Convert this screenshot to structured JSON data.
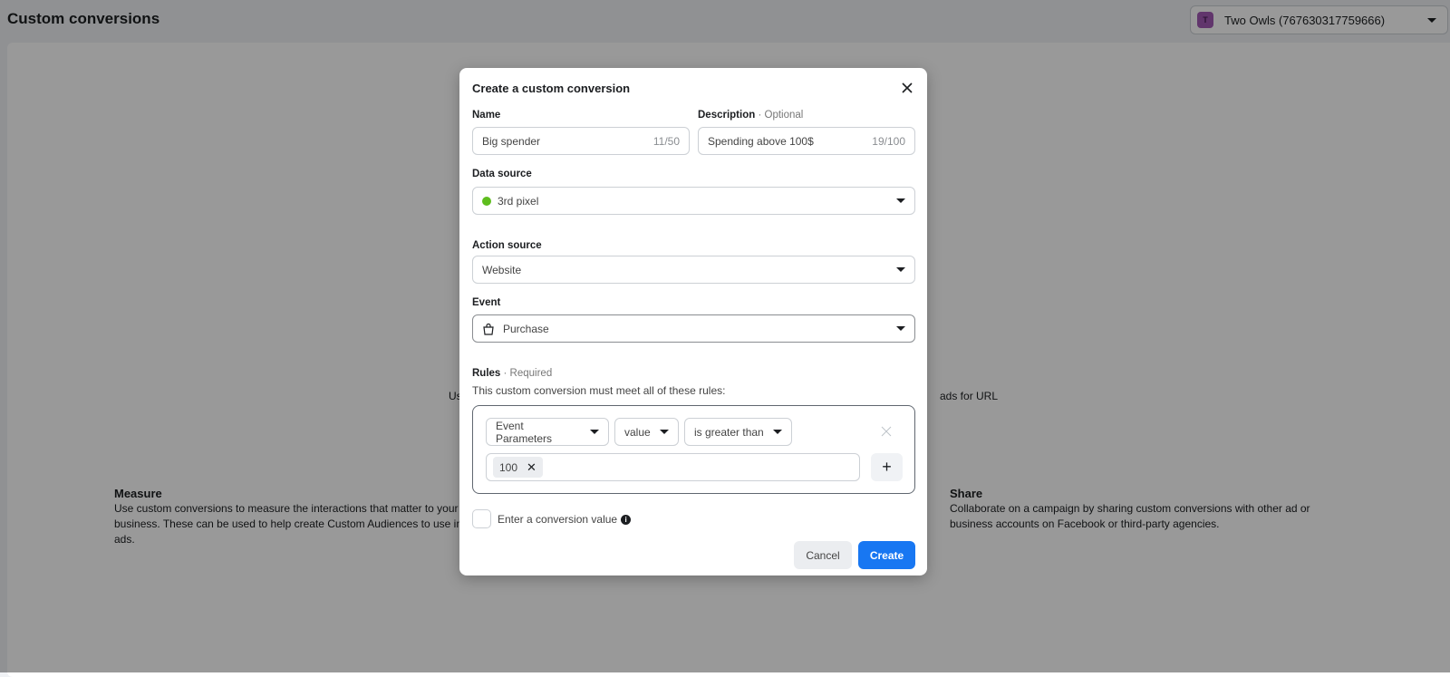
{
  "page": {
    "title": "Custom conversions",
    "account": {
      "initial": "T",
      "label": "Two Owls (767630317759666)"
    }
  },
  "background": {
    "partial_left": "Us",
    "partial_right": "ads for URL",
    "measure": {
      "title": "Measure",
      "text": "Use custom conversions to measure the interactions that matter to your business. These can be used to help create Custom Audiences to use in your ads."
    },
    "share": {
      "title": "Share",
      "text": "Collaborate on a campaign by sharing custom conversions with other ad or business accounts on Facebook or third-party agencies."
    }
  },
  "modal": {
    "title": "Create a custom conversion",
    "name": {
      "label": "Name",
      "value": "Big spender",
      "count": "11/50"
    },
    "description": {
      "label": "Description",
      "optional": "· Optional",
      "value": "Spending above 100$",
      "count": "19/100"
    },
    "data_source": {
      "label": "Data source",
      "value": "3rd pixel",
      "status_color": "#5ebd1e"
    },
    "action_source": {
      "label": "Action source",
      "value": "Website"
    },
    "event": {
      "label": "Event",
      "value": "Purchase",
      "icon": "shopping-bag-icon"
    },
    "rules": {
      "label": "Rules",
      "required": "· Required",
      "description": "This custom conversion must meet all of these rules:",
      "parameter": "Event Parameters",
      "field": "value",
      "operator": "is greater than",
      "values": [
        "100"
      ]
    },
    "conversion_value": {
      "label": "Enter a conversion value",
      "checked": false
    },
    "cancel_label": "Cancel",
    "create_label": "Create",
    "accent": "#1877f2"
  }
}
